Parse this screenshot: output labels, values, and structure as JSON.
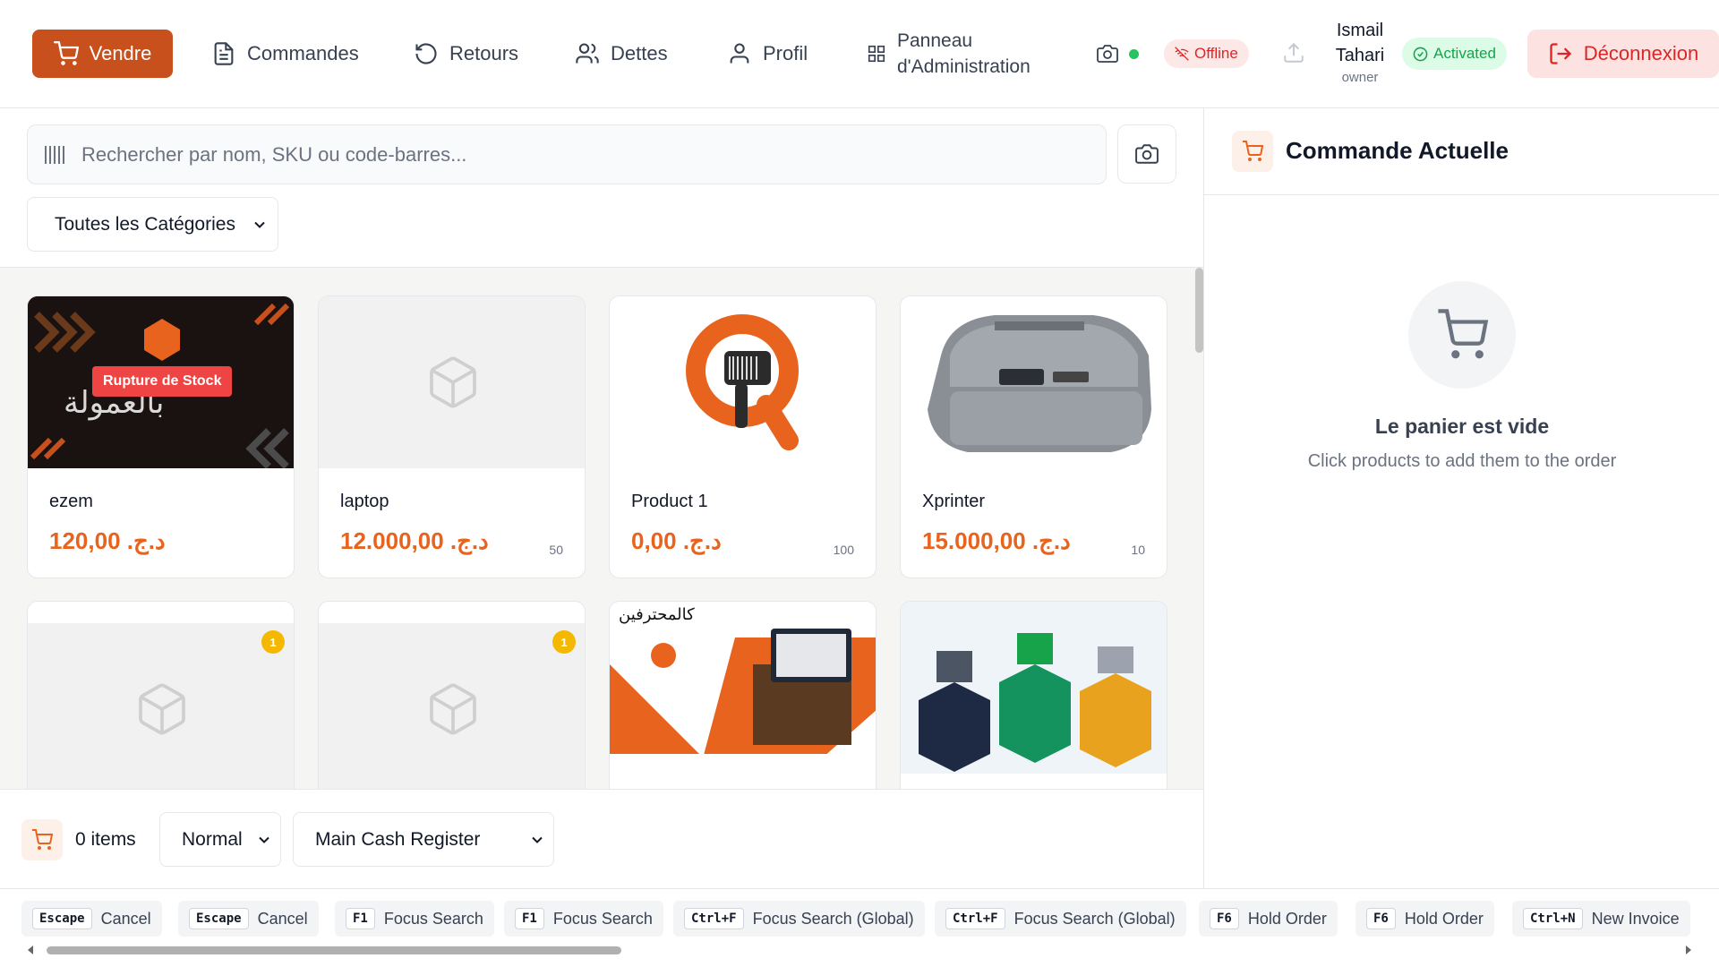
{
  "nav": {
    "items": [
      {
        "label": "Vendre",
        "icon": "cart-icon"
      },
      {
        "label": "Commandes",
        "icon": "document-icon"
      },
      {
        "label": "Retours",
        "icon": "undo-icon"
      },
      {
        "label": "Dettes",
        "icon": "users-icon"
      },
      {
        "label": "Profil",
        "icon": "user-icon"
      },
      {
        "label_line1": "Panneau",
        "label_line2": "d'Administration",
        "icon": "grid-icon"
      }
    ],
    "active": "Vendre"
  },
  "status": {
    "offline_label": "Offline",
    "activated_label": "Activated",
    "connection_dot_color": "#22c55e"
  },
  "user": {
    "first": "Ismail",
    "last": "Tahari",
    "role": "owner"
  },
  "logout_label": "Déconnexion",
  "search": {
    "placeholder": "Rechercher par nom, SKU ou code-barres..."
  },
  "category_filter": {
    "selected": "Toutes les Catégories"
  },
  "products": [
    {
      "name": "ezem",
      "price": "د.ج. 120,00",
      "stock": "",
      "badge": "Rupture de Stock"
    },
    {
      "name": "laptop",
      "price": "د.ج. 12.000,00",
      "stock": "50"
    },
    {
      "name": "Product 1",
      "price": "د.ج. 0,00",
      "stock": "100"
    },
    {
      "name": "Xprinter",
      "price": "د.ج. 15.000,00",
      "stock": "10"
    },
    {
      "name": "",
      "price": "",
      "stock": "",
      "count": "1"
    },
    {
      "name": "",
      "price": "",
      "stock": "",
      "count": "1"
    },
    {
      "name": "",
      "price": "",
      "stock": ""
    },
    {
      "name": "",
      "price": "",
      "stock": ""
    }
  ],
  "bottom": {
    "items_label": "0 items",
    "order_type": "Normal",
    "register": "Main Cash Register"
  },
  "order_panel": {
    "title": "Commande Actuelle",
    "empty_title": "Le panier est vide",
    "empty_subtitle": "Click products to add them to the order"
  },
  "shortcuts": [
    {
      "key": "Escape",
      "label": "Cancel"
    },
    {
      "key": "Escape",
      "label": "Cancel"
    },
    {
      "key": "F1",
      "label": "Focus Search"
    },
    {
      "key": "F1",
      "label": "Focus Search"
    },
    {
      "key": "Ctrl+F",
      "label": "Focus Search (Global)"
    },
    {
      "key": "Ctrl+F",
      "label": "Focus Search (Global)"
    },
    {
      "key": "F6",
      "label": "Hold Order"
    },
    {
      "key": "F6",
      "label": "Hold Order"
    },
    {
      "key": "Ctrl+N",
      "label": "New Invoice"
    }
  ],
  "colors": {
    "accent": "#c8501d",
    "price": "#e8641e",
    "danger": "#dc2626",
    "success": "#16a34a"
  }
}
